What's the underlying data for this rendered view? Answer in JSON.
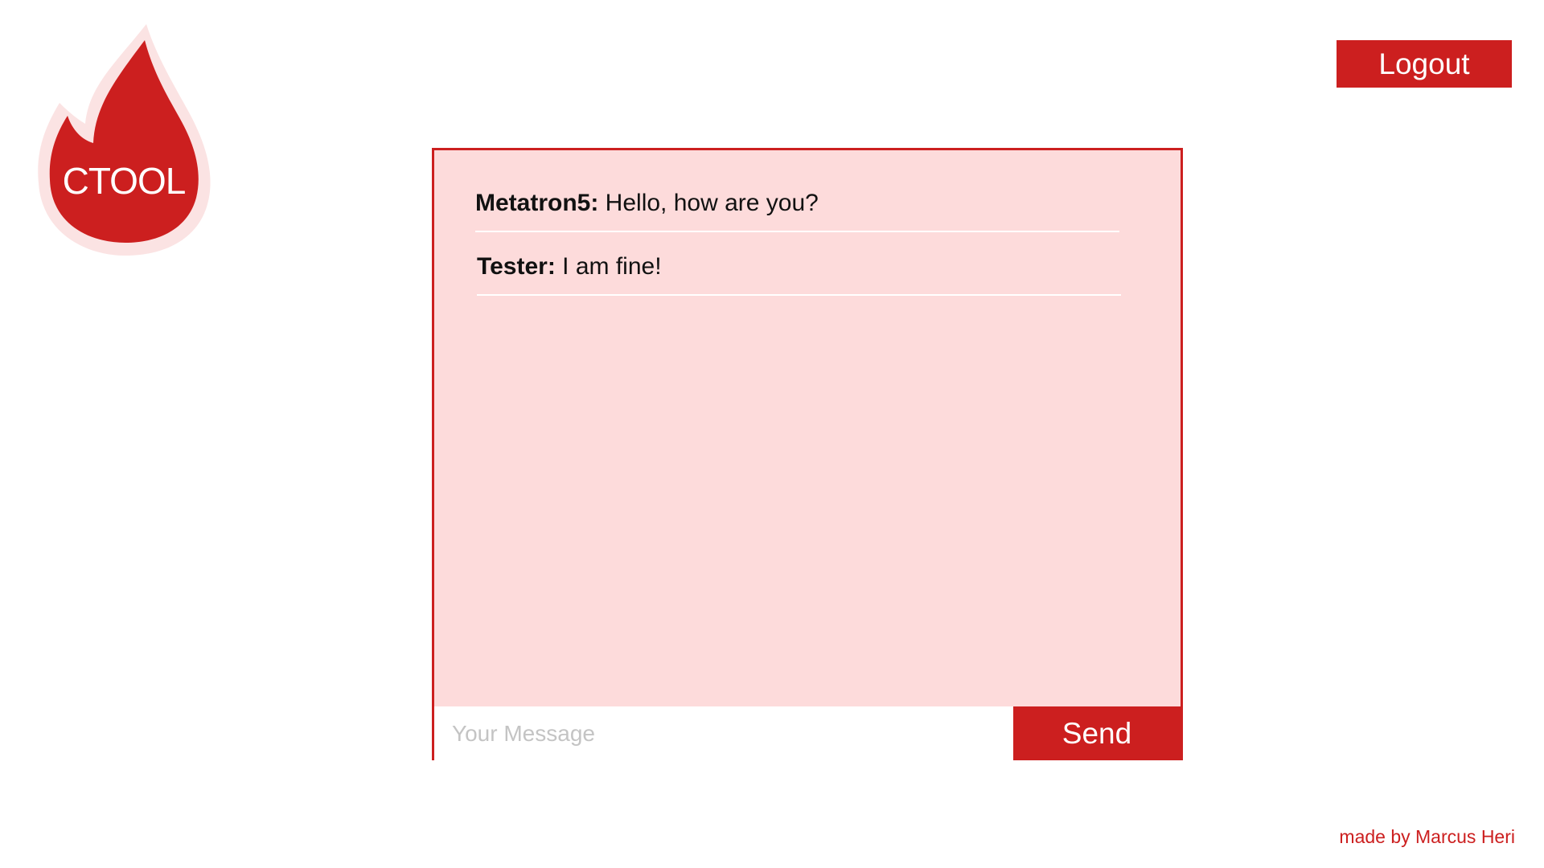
{
  "logo": {
    "text": "CTOOL",
    "icon": "flame-icon"
  },
  "header": {
    "logout_label": "Logout"
  },
  "chat": {
    "messages": [
      {
        "author": "Metatron5:",
        "text": " Hello, how are you?"
      },
      {
        "author": "Tester:",
        "text": " I am fine!"
      }
    ],
    "input": {
      "placeholder": "Your Message",
      "value": ""
    },
    "send_label": "Send"
  },
  "footer": {
    "credit": "made by Marcus Heri"
  },
  "colors": {
    "accent": "#cc1f1f",
    "panel_background": "#fddbdb",
    "page_background": "#ffffff"
  }
}
